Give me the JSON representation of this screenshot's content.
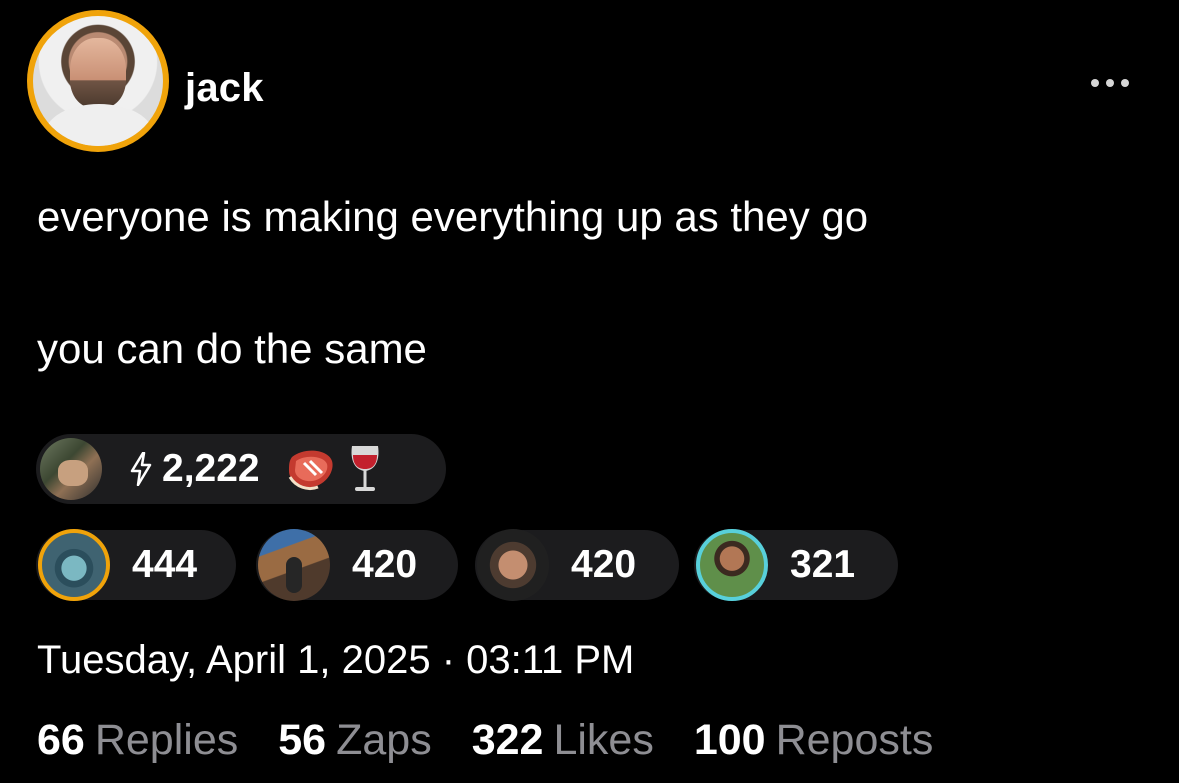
{
  "author": {
    "name": "jack",
    "avatar_icon": "profile-photo",
    "avatar_ring_color": "#f0a30a"
  },
  "menu": {
    "more_icon": "ellipsis-icon"
  },
  "post": {
    "lines": [
      "everyone is making everything up as they go",
      "you can do the same"
    ]
  },
  "top_zap": {
    "amount": "2,222",
    "icon": "lightning-icon",
    "emojis": [
      "steak-emoji",
      "wine-glass-emoji"
    ]
  },
  "zappers": [
    {
      "amount": "444"
    },
    {
      "amount": "420"
    },
    {
      "amount": "420"
    },
    {
      "amount": "321"
    }
  ],
  "timestamp": "Tuesday, April 1, 2025 · 03:11 PM",
  "stats": {
    "replies": {
      "count": "66",
      "label": "Replies"
    },
    "zaps": {
      "count": "56",
      "label": "Zaps"
    },
    "likes": {
      "count": "322",
      "label": "Likes"
    },
    "reposts": {
      "count": "100",
      "label": "Reposts"
    }
  },
  "colors": {
    "background": "#000000",
    "pill": "#1c1c1e",
    "muted_text": "#8e8e93",
    "accent": "#f0a30a"
  }
}
